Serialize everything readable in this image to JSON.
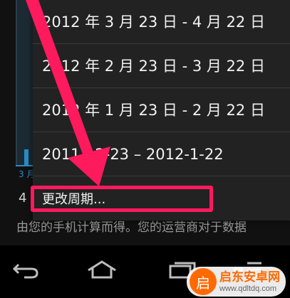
{
  "background": {
    "month_label": "3 月",
    "line_number": "4",
    "description_text": "由您的手机计算而得。您的运营商对于数据"
  },
  "menu": {
    "items": [
      {
        "label": "2012 年 3 月 23 日 - 4 月 22 日"
      },
      {
        "label": "2012 年 2 月 23 日 - 3 月 22 日"
      },
      {
        "label": "2012 年 1 月 23 日 - 2 月 22 日"
      },
      {
        "label": "2011-12-23 – 2012-1-22"
      },
      {
        "label": "更改周期..."
      }
    ]
  },
  "annotation": {
    "color": "#ff1a5e"
  },
  "navbar": {
    "buttons": [
      {
        "icon": "back-icon"
      },
      {
        "icon": "home-icon"
      },
      {
        "icon": "recent-apps-icon"
      },
      {
        "icon": "menu-icon"
      }
    ]
  },
  "watermark": {
    "title": "启东安卓网",
    "url": "www.qdltdq.com",
    "logo_char": "启"
  }
}
